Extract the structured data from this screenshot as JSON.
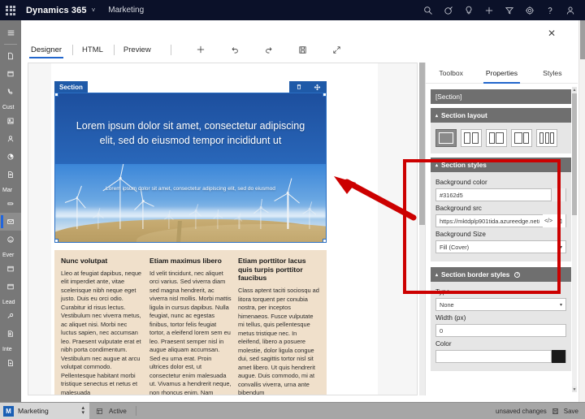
{
  "topbar": {
    "waffle": "app-launcher",
    "brand": "Dynamics 365",
    "brand_chevron": "˅",
    "app_name": "Marketing",
    "icons": [
      {
        "name": "search-icon",
        "label": "Search"
      },
      {
        "name": "target-icon",
        "label": "Goals"
      },
      {
        "name": "lightbulb-icon",
        "label": "Insights"
      },
      {
        "name": "plus-icon",
        "label": "New"
      },
      {
        "name": "filter-icon",
        "label": "Filter"
      },
      {
        "name": "gear-icon",
        "label": "Settings"
      },
      {
        "name": "help-icon",
        "label": "Help"
      },
      {
        "name": "person-icon",
        "label": "Account"
      }
    ]
  },
  "sidebar": {
    "hamburger": "☰",
    "groups": [
      {
        "label": "",
        "items": [
          {
            "name": "sidebar-item-recent",
            "icon": "page-icon"
          },
          {
            "name": "sidebar-item-pinned",
            "icon": "calendar-icon"
          },
          {
            "name": "sidebar-item-calls",
            "icon": "phone-icon"
          }
        ]
      },
      {
        "label": "Cust",
        "items": [
          {
            "name": "sidebar-item-accounts",
            "icon": "contact-card-icon"
          },
          {
            "name": "sidebar-item-contacts",
            "icon": "person-icon"
          },
          {
            "name": "sidebar-item-segments",
            "icon": "pie-icon"
          },
          {
            "name": "sidebar-item-subscriptions",
            "icon": "list-page-icon"
          }
        ]
      },
      {
        "label": "Mar",
        "items": [
          {
            "name": "sidebar-item-customer-journeys",
            "icon": "flow-icon"
          },
          {
            "name": "sidebar-item-marketing-emails",
            "icon": "mail-icon",
            "selected": true
          },
          {
            "name": "sidebar-item-social-posts",
            "icon": "smiley-icon"
          }
        ]
      },
      {
        "label": "Ever",
        "items": [
          {
            "name": "sidebar-item-events",
            "icon": "calendar-icon"
          },
          {
            "name": "sidebar-item-event-planning",
            "icon": "calendar-icon"
          }
        ]
      },
      {
        "label": "Lead",
        "items": [
          {
            "name": "sidebar-item-lead-scoring",
            "icon": "score-icon"
          },
          {
            "name": "sidebar-item-leads",
            "icon": "lead-person-icon"
          }
        ]
      },
      {
        "label": "Inte",
        "items": [
          {
            "name": "sidebar-item-forms",
            "icon": "form-page-icon"
          }
        ]
      }
    ]
  },
  "dialog": {
    "close_label": "✕"
  },
  "editor_toolbar": {
    "tabs": [
      {
        "label": "Designer",
        "active": true
      },
      {
        "label": "HTML",
        "active": false
      },
      {
        "label": "Preview",
        "active": false
      }
    ],
    "actions": [
      {
        "name": "add-element-button",
        "icon": "plus-icon"
      },
      {
        "name": "undo-button",
        "icon": "undo-icon"
      },
      {
        "name": "redo-button",
        "icon": "redo-icon"
      },
      {
        "name": "save-button",
        "icon": "save-icon"
      },
      {
        "name": "expand-button",
        "icon": "expand-icon"
      }
    ]
  },
  "canvas": {
    "section_tag": "Section",
    "section_actions": [
      {
        "name": "delete-section-button",
        "icon": "trash-icon"
      },
      {
        "name": "move-section-handle",
        "icon": "move-icon"
      }
    ],
    "hero": {
      "headline": "Lorem ipsum dolor sit amet, consectetur adipiscing elit, sed do eiusmod tempor incididunt ut",
      "subtitle": "Lorem ipsum dolor sit amet, consectetur adipiscing elit, sed do eiusmod",
      "background_color": "#3162d5",
      "image_alt": "wind-turbine-farm-photo"
    },
    "columns": [
      {
        "heading": "Nunc volutpat",
        "body": "Lleo at feugiat dapibus, neque elit imperdiet ante, vitae scelerisque nibh neque eget justo. Duis eu orci odio. Curabitur id risus lectus. Vestibulum nec viverra metus, ac aliquet nisi. Morbi nec luctus sapien, nec accumsan leo. Praesent vulputate erat et nibh porta condimentum. Vestibulum nec augue at arcu volutpat commodo. Pellentesque habitant morbi tristique senectus et netus et malesuada"
      },
      {
        "heading": "Etiam maximus libero",
        "body": "Id velit tincidunt, nec aliquet orci varius. Sed viverra diam sed magna hendrerit, ac viverra nisl mollis. Morbi mattis ligula in cursus dapibus. Nulla feugiat, nunc ac egestas finibus, tortor felis feugiat tortor, a eleifend lorem sem eu leo. Praesent semper nisl in augue aliquam accumsan. Sed eu urna erat. Proin ultrices dolor est, ut consectetur enim malesuada ut. Vivamus a hendrerit neque, non rhoncus enim. Nam"
      },
      {
        "heading": "Etiam porttitor lacus quis turpis porttitor faucibus",
        "body": "Class aptent taciti sociosqu ad litora torquent per conubia nostra, per inceptos himenaeos. Fusce vulputate mi tellus, quis pellentesque metus tristique nec. In eleifend, libero a posuere molestie, dolor ligula congue dui, sed sagittis tortor nisl sit amet libero. Ut quis hendrerit augue. Duis commodo, mi at convallis viverra, urna ante bibendum"
      }
    ]
  },
  "properties_panel": {
    "tabs": [
      {
        "label": "Toolbox",
        "active": false
      },
      {
        "label": "Properties",
        "active": true
      },
      {
        "label": "Styles",
        "active": false
      }
    ],
    "selected_entity": "[Section]",
    "section_layout": {
      "title": "Section layout",
      "caret": "▴",
      "options": [
        {
          "name": "layout-one-column",
          "selected": true
        },
        {
          "name": "layout-two-equal",
          "selected": false
        },
        {
          "name": "layout-narrow-wide",
          "selected": false
        },
        {
          "name": "layout-wide-narrow",
          "selected": false
        },
        {
          "name": "layout-three-column",
          "selected": false
        }
      ]
    },
    "section_styles": {
      "title": "Section styles",
      "caret": "▴",
      "background_color_label": "Background color",
      "background_color_value": "#3162d5",
      "background_src_label": "Background src",
      "background_src_value": "https://mktdplp901tida.azureedge.net/c",
      "background_size_label": "Background Size",
      "background_size_value": "Fill (Cover)",
      "code_icon": "</>",
      "browse_icon": "file-picker-icon"
    },
    "section_border_styles": {
      "title": "Section border styles",
      "caret": "▴",
      "info_icon": "info-icon",
      "type_label": "Type",
      "type_value": "None",
      "width_label": "Width (px)",
      "width_value": "0",
      "color_label": "Color"
    }
  },
  "annotation": {
    "box_color": "#cc0000",
    "arrow_color": "#cc0000",
    "box_target": "section-styles-group",
    "arrow_target": "hero-background-image"
  },
  "statusbar": {
    "app_initial": "M",
    "app_name": "Marketing",
    "switcher_icon": "up-down-chevrons",
    "grid_icon": "sitemap-icon",
    "state": "Active",
    "unsaved": "unsaved changes",
    "save_icon": "save-icon",
    "save_label": "Save"
  }
}
